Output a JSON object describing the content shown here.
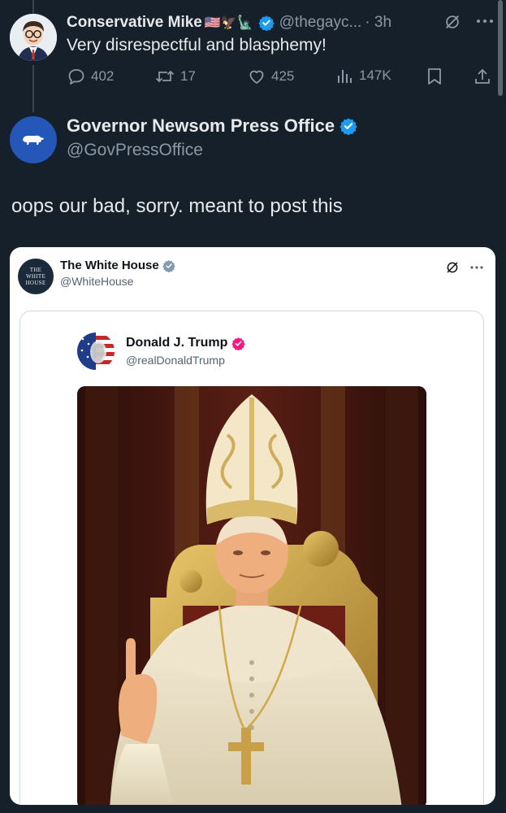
{
  "reply": {
    "name": "Conservative Mike",
    "flag_emojis": "🇺🇸🦅🗽",
    "handle": "@thegayc...",
    "time": "· 3h",
    "text": "Very disrespectful and blasphemy!",
    "stats": {
      "replies": "402",
      "reposts": "17",
      "likes": "425",
      "views": "147K"
    }
  },
  "tweet": {
    "name": "Governor Newsom Press Office",
    "handle": "@GovPressOffice",
    "text": "oops our bad, sorry. meant to post this"
  },
  "embedded": {
    "account_name": "The White House",
    "account_handle": "@WhiteHouse",
    "avatar_text": [
      "THE",
      "WHITE",
      "HOUSE"
    ],
    "quoted": {
      "name": "Donald J. Trump",
      "handle": "@realDonaldTrump"
    }
  },
  "colors": {
    "background": "#15202b",
    "verified_blue": "#1d9bf0",
    "verified_red": "#f91880",
    "muted": "#8b98a5"
  },
  "icons": [
    "reply-icon",
    "repost-icon",
    "like-icon",
    "views-icon",
    "bookmark-icon",
    "share-icon",
    "grok-icon",
    "more-icon",
    "verified-badge-icon"
  ]
}
